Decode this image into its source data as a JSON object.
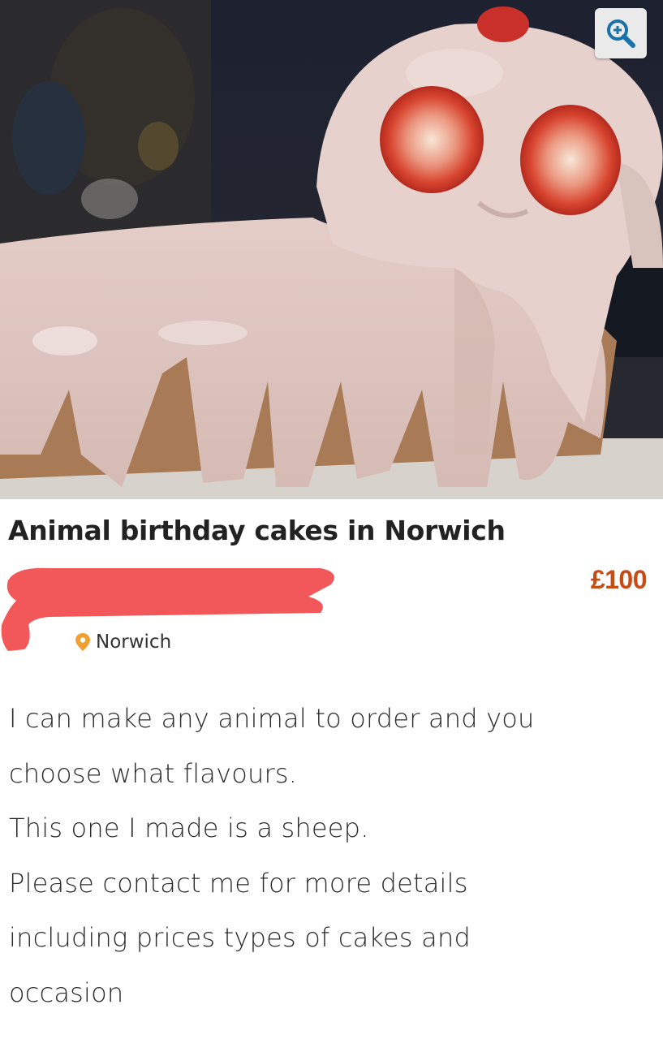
{
  "listing": {
    "title": "Animal birthday cakes in Norwich",
    "price": "£100",
    "location": "Norwich",
    "description_lines": [
      "I can make any animal to order and you",
      "choose what flavours.",
      "This one I made is a sheep.",
      "Please contact me for more details",
      "including prices types of cakes and",
      "occasion"
    ]
  },
  "icons": {
    "zoom": "zoom-in-icon",
    "location": "map-pin-icon"
  },
  "colors": {
    "price": "#c84a14",
    "pin": "#f0a030",
    "redaction": "#f2585a"
  }
}
